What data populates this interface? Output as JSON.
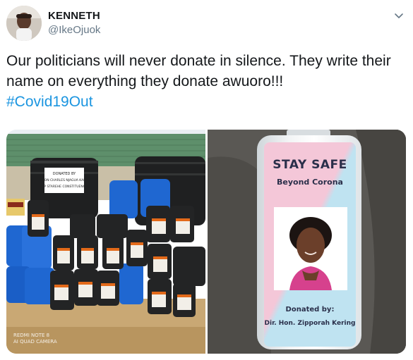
{
  "author": {
    "display_name": "KENNETH",
    "handle": "@IkeOjuok"
  },
  "tweet": {
    "text": "Our politicians will never donate in silence. They write their name on everything they donate awuoro!!!",
    "hashtag": "#Covid19Out"
  },
  "icons": {
    "menu": "chevron-down-icon"
  },
  "media": {
    "left_photo": {
      "tank_label_lines": [
        "DONATED BY",
        "HON CHARLES NJAGUA KARI",
        "MP STAREHE CONSTITUENCY"
      ],
      "watermark": [
        "REDMI NOTE 8",
        "AI QUAD CAMERA"
      ]
    },
    "right_photo": {
      "label_title": "STAY SAFE",
      "label_subtitle": "Beyond Corona",
      "donated_by": "Donated by:",
      "donor_name": "Dir. Hon. Zipporah Kering"
    }
  },
  "colors": {
    "text": "#14171a",
    "secondary": "#657786",
    "link": "#1b95e0"
  }
}
